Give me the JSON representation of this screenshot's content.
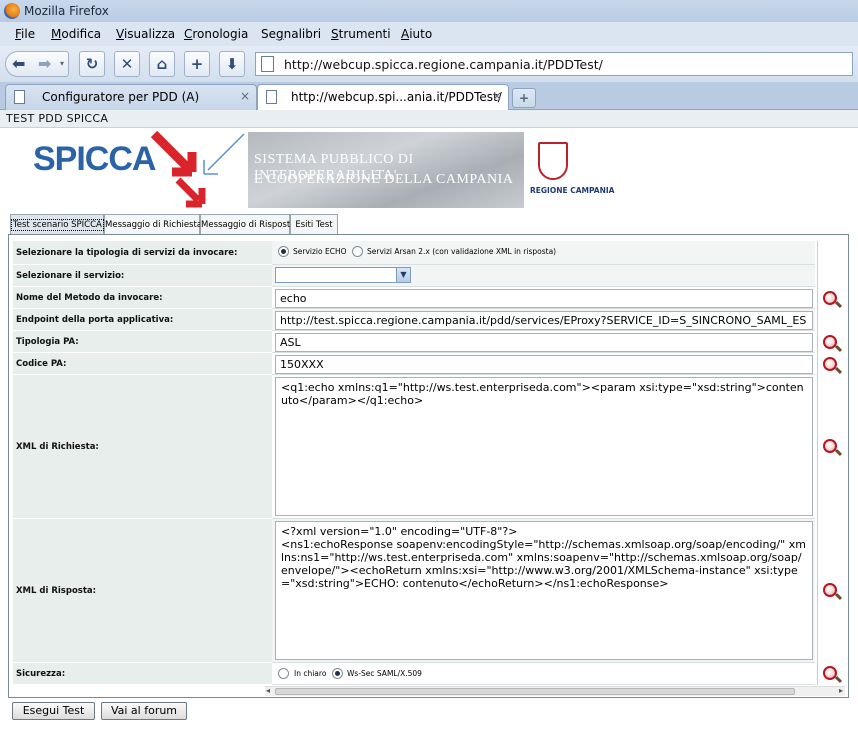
{
  "window": {
    "title": "Mozilla Firefox"
  },
  "menu": [
    "File",
    "Modifica",
    "Visualizza",
    "Cronologia",
    "Segnalibri",
    "Strumenti",
    "Aiuto"
  ],
  "menu_underline": [
    "F",
    "M",
    "V",
    "C",
    "g",
    "S",
    "A"
  ],
  "navigation": {
    "url": "http://webcup.spicca.regione.campania.it/PDDTest/"
  },
  "tabs": [
    {
      "label": "Configuratore per PDD (A)",
      "close": "×"
    },
    {
      "label": "http://webcup.spi...ania.it/PDDTest/",
      "close": "×"
    }
  ],
  "page": {
    "header": "TEST PDD SPICCA",
    "banner": {
      "logo": "SPICCA",
      "line1": "SISTEMA PUBBLICO DI INTEROPERABILITA'",
      "line2": "E COOPERAZIONE DELLA CAMPANIA",
      "regione": "REGIONE CAMPANIA"
    },
    "tabs": [
      "Test scenario SPICCA",
      "Messaggio di Richiesta",
      "Messaggio di Risposta",
      "Esiti Test"
    ],
    "form": {
      "tipologia_label": "Selezionare la tipologia di servizi da invocare:",
      "tipologia_opt1": "Servizio ECHO",
      "tipologia_opt2": "Servizi Arsan 2.x (con validazione XML in risposta)",
      "servizio_label": "Selezionare il servizio:",
      "servizio_value": "",
      "metodo_label": "Nome del Metodo da invocare:",
      "metodo_value": "echo",
      "endpoint_label": "Endpoint della porta applicativa:",
      "endpoint_value": "http://test.spicca.regione.campania.it/pdd/services/EProxy?SERVICE_ID=S_SINCRONO_SAML_ES",
      "tipologia_pa_label": "Tipologia PA:",
      "tipologia_pa_value": "ASL",
      "codice_pa_label": "Codice PA:",
      "codice_pa_value": "150XXX",
      "xml_req_label": "XML di Richiesta:",
      "xml_req_value": "<q1:echo xmlns:q1=\"http://ws.test.enterpriseda.com\"><param xsi:type=\"xsd:string\">contenuto</param></q1:echo>",
      "xml_resp_label": "XML di Risposta:",
      "xml_resp_value": "<?xml version=\"1.0\" encoding=\"UTF-8\"?>\n<ns1:echoResponse soapenv:encodingStyle=\"http://schemas.xmlsoap.org/soap/encoding/\" xmlns:ns1=\"http://ws.test.enterpriseda.com\" xmlns:soapenv=\"http://schemas.xmlsoap.org/soap/envelope/\"><echoReturn xmlns:xsi=\"http://www.w3.org/2001/XMLSchema-instance\" xsi:type=\"xsd:string\">ECHO: contenuto</echoReturn></ns1:echoResponse>",
      "sicurezza_label": "Sicurezza:",
      "sicurezza_opt1": "In chiaro",
      "sicurezza_opt2": "Ws-Sec SAML/X.509"
    },
    "buttons": {
      "esegui": "Esegui Test",
      "forum": "Vai al forum"
    }
  },
  "colors": {
    "accent": "#2b63a8",
    "label_bg": "#e7eeec",
    "brand_red": "#b8232c"
  }
}
